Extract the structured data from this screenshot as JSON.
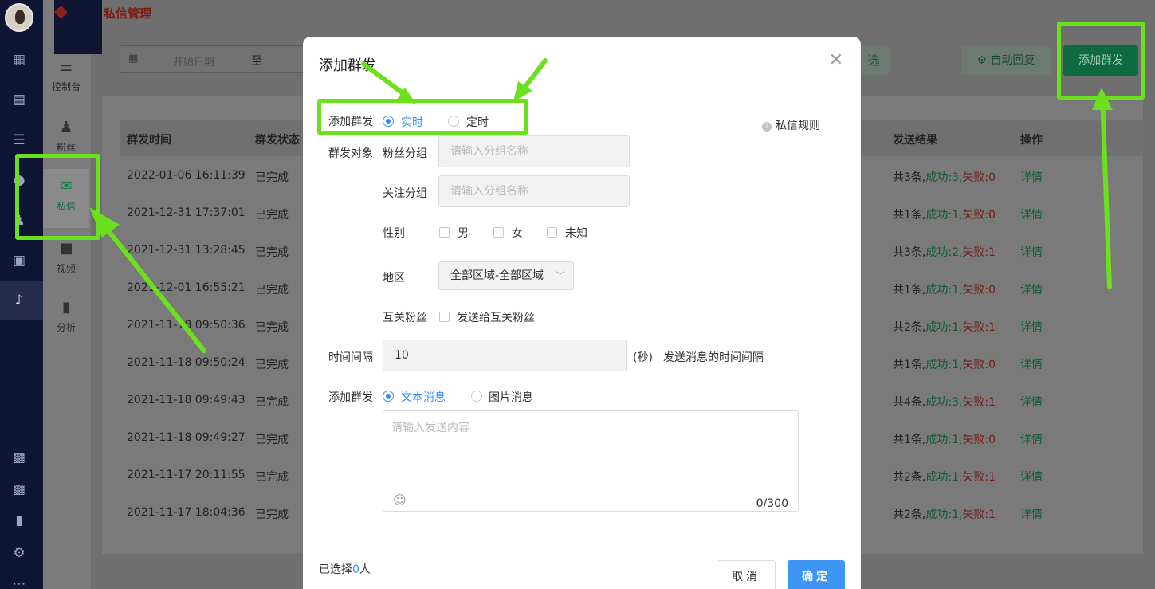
{
  "header": {
    "page_title": "私信管理",
    "logo_icon": "fox-logo-icon"
  },
  "rail": {
    "icons": [
      "dashboard-icon",
      "chat-icon",
      "list-icon",
      "circle-icon",
      "user-icon",
      "clipboard-icon",
      "tiktok-icon",
      "robot-icon",
      "robot-alt-icon",
      "bar-chart-icon",
      "gear-icon",
      "more-icon"
    ]
  },
  "subnav": {
    "items": [
      {
        "label": "控制台",
        "icon": "sliders-icon"
      },
      {
        "label": "粉丝",
        "icon": "users-icon"
      },
      {
        "label": "私信",
        "icon": "mail-icon",
        "active": true
      },
      {
        "label": "视频",
        "icon": "video-icon"
      },
      {
        "label": "分析",
        "icon": "bar-chart-icon"
      }
    ]
  },
  "filters": {
    "start_placeholder": "开始日期",
    "to_label": "至",
    "select_label": "选",
    "auto_reply_label": "自动回复",
    "add_broadcast_label": "添加群发"
  },
  "table": {
    "columns": [
      "群发时间",
      "群发状态",
      "发送结果",
      "操作"
    ],
    "rows": [
      {
        "time": "2022-01-06 16:11:39",
        "status": "已完成",
        "total": "共3条,",
        "ok": "成功:3,",
        "fail": "失败:0",
        "action": "详情"
      },
      {
        "time": "2021-12-31 17:37:01",
        "status": "已完成",
        "total": "共1条,",
        "ok": "成功:1,",
        "fail": "失败:0",
        "action": "详情"
      },
      {
        "time": "2021-12-31 13:28:45",
        "status": "已完成",
        "total": "共3条,",
        "ok": "成功:2,",
        "fail": "失败:1",
        "action": "详情"
      },
      {
        "time": "2021-12-01 16:55:21",
        "status": "已完成",
        "total": "共1条,",
        "ok": "成功:1,",
        "fail": "失败:0",
        "action": "详情"
      },
      {
        "time": "2021-11-18 09:50:36",
        "status": "已完成",
        "total": "共2条,",
        "ok": "成功:1,",
        "fail": "失败:1",
        "action": "详情"
      },
      {
        "time": "2021-11-18 09:50:24",
        "status": "已完成",
        "total": "共1条,",
        "ok": "成功:1,",
        "fail": "失败:0",
        "action": "详情"
      },
      {
        "time": "2021-11-18 09:49:43",
        "status": "已完成",
        "total": "共4条,",
        "ok": "成功:3,",
        "fail": "失败:1",
        "action": "详情"
      },
      {
        "time": "2021-11-18 09:49:27",
        "status": "已完成",
        "total": "共1条,",
        "ok": "成功:1,",
        "fail": "失败:0",
        "action": "详情"
      },
      {
        "time": "2021-11-17 20:11:55",
        "status": "已完成",
        "total": "共2条,",
        "ok": "成功:1,",
        "fail": "失败:1",
        "action": "详情"
      },
      {
        "time": "2021-11-17 18:04:36",
        "status": "已完成",
        "total": "共2条,",
        "ok": "成功:1,",
        "fail": "失败:1",
        "action": "详情"
      }
    ]
  },
  "modal": {
    "title": "添加群发",
    "rules_label": "私信规则",
    "send_type": {
      "label": "添加群发",
      "options": [
        "实时",
        "定时"
      ],
      "selected": "实时"
    },
    "target": {
      "label": "群发对象",
      "fan_group_label": "粉丝分组",
      "fan_group_placeholder": "请输入分组名称",
      "follow_group_label": "关注分组",
      "follow_group_placeholder": "请输入分组名称",
      "gender_label": "性别",
      "gender_options": [
        "男",
        "女",
        "未知"
      ],
      "region_label": "地区",
      "region_value": "全部区域-全部区域",
      "mutual_label": "互关粉丝",
      "mutual_option": "发送给互关粉丝"
    },
    "interval": {
      "label": "时间间隔",
      "value": "10",
      "unit": "(秒)",
      "hint": "发送消息的时间间隔"
    },
    "message": {
      "label": "添加群发",
      "options": [
        "文本消息",
        "图片消息"
      ],
      "selected": "文本消息",
      "placeholder": "请输入发送内容",
      "counter": "0/300"
    },
    "selected_prefix": "已选择",
    "selected_count": "0",
    "selected_suffix": "人",
    "cancel_label": "取消",
    "confirm_label": "确定"
  },
  "colors": {
    "annotation": "#6ae11c",
    "primary_blue": "#2f8cff",
    "brand_green": "#0e6a3f"
  }
}
